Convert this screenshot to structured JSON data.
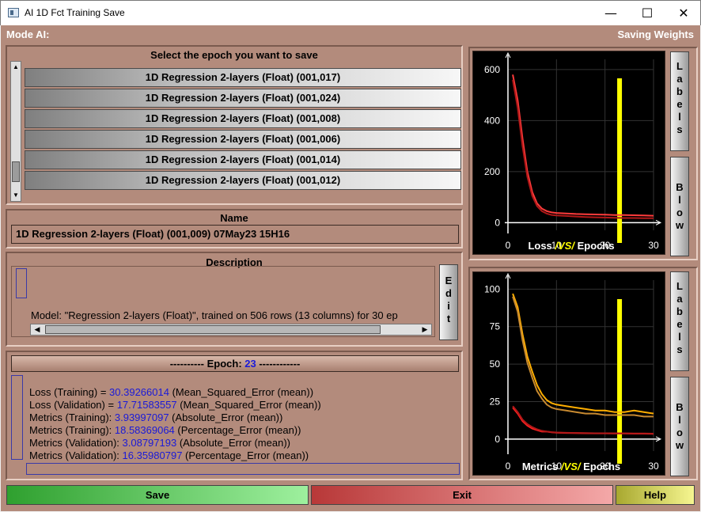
{
  "window": {
    "title": "AI 1D Fct Training Save",
    "minimize": "—",
    "maximize": "☐",
    "close": "✕"
  },
  "header": {
    "mode": "Mode AI:",
    "right": "Saving Weights"
  },
  "epoch_list": {
    "title": "Select the epoch you want to save",
    "items": [
      "1D Regression 2-layers (Float) (001,017)",
      "1D Regression 2-layers (Float) (001,024)",
      "1D Regression 2-layers (Float) (001,008)",
      "1D Regression 2-layers (Float) (001,006)",
      "1D Regression 2-layers (Float) (001,014)",
      "1D Regression 2-layers (Float) (001,012)"
    ]
  },
  "name": {
    "title": "Name",
    "value": "1D Regression 2-layers (Float) (001,009) 07May23 15H16"
  },
  "description": {
    "title": "Description",
    "text": "Model: \"Regression 2-layers (Float)\", trained on 506 rows (13 columns) for 30 ep",
    "edit_letters": [
      "E",
      "d",
      "i",
      "t"
    ]
  },
  "epoch_info": {
    "prefix": "---------- Epoch: ",
    "number": "23",
    "suffix": " ------------",
    "metrics": [
      {
        "label": "Loss (Training) = ",
        "value": "30.39266014",
        "desc": " (Mean_Squared_Error (mean))"
      },
      {
        "label": "Loss (Validation) = ",
        "value": "17.71583557",
        "desc": " (Mean_Squared_Error (mean))"
      },
      {
        "label": "Metrics (Training): ",
        "value": "3.93997097",
        "desc": " (Absolute_Error (mean))"
      },
      {
        "label": "Metrics (Training): ",
        "value": "18.58369064",
        "desc": " (Percentage_Error (mean))"
      },
      {
        "label": "Metrics (Validation): ",
        "value": "3.08797193",
        "desc": " (Absolute_Error (mean))"
      },
      {
        "label": "Metrics (Validation): ",
        "value": "16.35980797",
        "desc": " (Percentage_Error (mean))"
      }
    ]
  },
  "side_buttons": {
    "labels_letters": [
      "L",
      "a",
      "b",
      "e",
      "l",
      "s"
    ],
    "blow_letters": [
      "B",
      "l",
      "o",
      "w"
    ]
  },
  "bottom_buttons": {
    "save": "Save",
    "exit": "Exit",
    "help": "Help"
  },
  "colors": {
    "background": "#b38b7c",
    "training_line": "#ff3b3b",
    "validation_line_loss": "#c02a2a",
    "metrics_line_1": "#ffae00",
    "metrics_line_2": "#ff2020",
    "epoch_marker": "#ffff00",
    "accent_value": "#1a1ad8"
  },
  "chart_data": [
    {
      "type": "line",
      "title_parts": [
        "Loss ",
        "/VS/",
        " Epochs"
      ],
      "xlim": [
        0,
        30
      ],
      "ylim": [
        -30,
        640
      ],
      "x_ticks": [
        0,
        10,
        20,
        30
      ],
      "y_ticks": [
        0,
        200,
        400,
        600
      ],
      "marker_x": 23,
      "grid": true,
      "series": [
        {
          "color": "#ff3b3b",
          "x": [
            1,
            2,
            3,
            4,
            5,
            6,
            7,
            8,
            9,
            10,
            12,
            14,
            16,
            18,
            20,
            22,
            24,
            26,
            28,
            30
          ],
          "y": [
            580,
            480,
            330,
            200,
            120,
            75,
            55,
            45,
            40,
            38,
            36,
            34,
            33,
            32,
            31,
            30,
            30,
            29,
            28,
            27
          ]
        },
        {
          "color": "#b01818",
          "x": [
            1,
            2,
            3,
            4,
            5,
            6,
            7,
            8,
            9,
            10,
            12,
            14,
            16,
            18,
            20,
            22,
            24,
            26,
            28,
            30
          ],
          "y": [
            560,
            450,
            300,
            180,
            105,
            65,
            45,
            35,
            30,
            28,
            26,
            24,
            22,
            21,
            20,
            19,
            18,
            18,
            17,
            17
          ]
        }
      ]
    },
    {
      "type": "line",
      "title_parts": [
        "Metrics ",
        "/VS/",
        " Epochs"
      ],
      "xlim": [
        0,
        30
      ],
      "ylim": [
        -8,
        106
      ],
      "x_ticks": [
        0,
        10,
        20,
        30
      ],
      "y_ticks": [
        0,
        25,
        50,
        75,
        100
      ],
      "marker_x": 23,
      "grid": true,
      "series": [
        {
          "color": "#ffae00",
          "x": [
            1,
            2,
            3,
            4,
            5,
            6,
            7,
            8,
            9,
            10,
            12,
            14,
            16,
            18,
            20,
            22,
            24,
            26,
            28,
            30
          ],
          "y": [
            97,
            88,
            70,
            55,
            45,
            36,
            30,
            26,
            24,
            23,
            22,
            21,
            20,
            19,
            19,
            18,
            18,
            19,
            18,
            17
          ]
        },
        {
          "color": "#c88a30",
          "x": [
            1,
            2,
            3,
            4,
            5,
            6,
            7,
            8,
            9,
            10,
            12,
            14,
            16,
            18,
            20,
            22,
            24,
            26,
            28,
            30
          ],
          "y": [
            95,
            85,
            66,
            51,
            41,
            32,
            27,
            23,
            21,
            20,
            19,
            18,
            17,
            17,
            16,
            16,
            16,
            16,
            15,
            15
          ]
        },
        {
          "color": "#ff2020",
          "x": [
            1,
            2,
            3,
            4,
            5,
            6,
            7,
            8,
            9,
            10,
            12,
            14,
            16,
            18,
            20,
            22,
            24,
            26,
            28,
            30
          ],
          "y": [
            21,
            17,
            12,
            9,
            7,
            6,
            5,
            5,
            4.5,
            4.3,
            4.1,
            4,
            3.9,
            3.8,
            3.8,
            3.7,
            3.7,
            3.6,
            3.6,
            3.5
          ]
        },
        {
          "color": "#b01818",
          "x": [
            1,
            2,
            3,
            4,
            5,
            6,
            7,
            8,
            9,
            10,
            12,
            14,
            16,
            18,
            20,
            22,
            24,
            26,
            28,
            30
          ],
          "y": [
            22,
            18,
            13,
            10,
            8,
            6.5,
            5.5,
            5,
            4.6,
            4.4,
            4.2,
            4.1,
            4,
            3.9,
            3.9,
            3.8,
            3.8,
            3.7,
            3.7,
            3.6
          ]
        }
      ]
    }
  ]
}
